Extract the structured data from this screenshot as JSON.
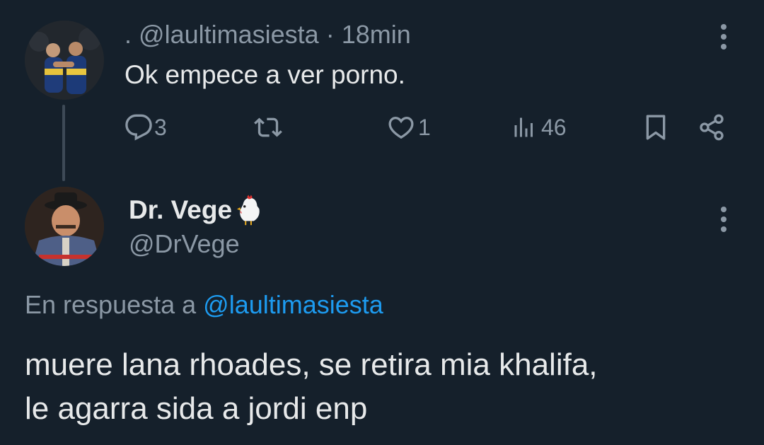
{
  "tweet1": {
    "display_name": ".",
    "handle": "@laultimasiesta",
    "separator": "·",
    "time": "18min",
    "text": "Ok empece a ver porno.",
    "actions": {
      "replies": "3",
      "retweets": "",
      "likes": "1",
      "views": "46"
    }
  },
  "tweet2": {
    "display_name": "Dr. Vege",
    "name_emoji": "🐔",
    "handle": "@DrVege",
    "reply_prefix": "En respuesta a",
    "reply_mention": "@laultimasiesta",
    "text_line1": "muere lana rhoades, se retira mia khalifa,",
    "text_line2": "le agarra sida a jordi enp"
  },
  "colors": {
    "background": "#15202b",
    "primary_text": "#e7e9ea",
    "secondary_text": "#8b98a5",
    "accent": "#1d9bf0",
    "thread_line": "#3e4a57"
  },
  "icons": [
    "more-vertical-icon",
    "reply-icon",
    "retweet-icon",
    "like-icon",
    "views-icon",
    "bookmark-icon",
    "share-icon",
    "chicken-emoji-icon"
  ]
}
